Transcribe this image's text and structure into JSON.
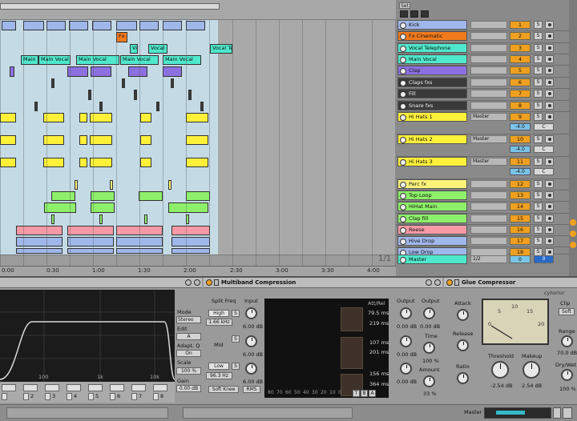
{
  "header": {
    "set_label": "Set"
  },
  "ruler": {
    "times": [
      "0:00",
      "0:30",
      "1:00",
      "1:30",
      "2:00",
      "2:30",
      "3:00",
      "3:30",
      "4:00"
    ],
    "position": "1/1"
  },
  "clip_labels": {
    "fx": "Fx Ci",
    "v": "Vi",
    "vocal": "Vocal",
    "vocal_tel": "Vocal Te",
    "main_a": "Main V",
    "main_b": "Main Vocal",
    "main_c": "Main Vocal",
    "main_d": "Main Vocal",
    "main_e": "Main Vocal"
  },
  "tracks": [
    {
      "name": "Kick",
      "num": "1",
      "color": "#9fb7ea"
    },
    {
      "name": "Fx Cinematic",
      "num": "2",
      "color": "#f07a1c"
    },
    {
      "name": "Vocal Telephone",
      "num": "3",
      "color": "#4fe8cc"
    },
    {
      "name": "Main Vocal",
      "num": "4",
      "color": "#4fe8cc"
    },
    {
      "name": "Clap",
      "num": "5",
      "color": "#8c70e0"
    },
    {
      "name": "Claps fxs",
      "num": "6",
      "color": "#3a3a3a"
    },
    {
      "name": "Fill",
      "num": "7",
      "color": "#3a3a3a"
    },
    {
      "name": "Snare fxs",
      "num": "8",
      "color": "#3a3a3a"
    },
    {
      "name": "Hi Hats 1",
      "num": "9",
      "color": "#fff03a",
      "out": "Master",
      "vol": "-4.0",
      "pan": "C"
    },
    {
      "name": "Hi Hats 2",
      "num": "10",
      "color": "#fff03a",
      "out": "Master",
      "vol": "-4.0",
      "pan": "C"
    },
    {
      "name": "Hi Hats 3",
      "num": "11",
      "color": "#fff03a",
      "out": "Master",
      "vol": "-4.0",
      "pan": "C"
    },
    {
      "name": "Perc fx",
      "num": "12",
      "color": "#fff27a"
    },
    {
      "name": "Top Loop",
      "num": "13",
      "color": "#8ef06a"
    },
    {
      "name": "HiHat Main",
      "num": "14",
      "color": "#8ef06a"
    },
    {
      "name": "Clap fill",
      "num": "15",
      "color": "#8ef06a"
    },
    {
      "name": "Reese",
      "num": "16",
      "color": "#f79aa6"
    },
    {
      "name": "Hive Drop",
      "num": "17",
      "color": "#9fb7ea"
    },
    {
      "name": "Low Drop",
      "num": "18",
      "color": "#9fb7ea"
    }
  ],
  "master": {
    "name": "Master",
    "io": "1/2",
    "vol": "0",
    "pan": "0"
  },
  "solo_label": "S",
  "eq": {
    "freq_labels": [
      "100",
      "1k",
      "10k"
    ],
    "mode_label": "Mode",
    "mode_value": "Stereo",
    "edit_label": "Edit",
    "edit_value": "A",
    "adapt_label": "Adapt. Q",
    "adapt_value": "On",
    "scale_label": "Scale",
    "scale_value": "100 %",
    "gain_label": "Gain",
    "gain_value": "0.00 dB",
    "band_numbers": [
      "2",
      "3",
      "4",
      "5",
      "6",
      "7",
      "8"
    ]
  },
  "mbc": {
    "title": "Multiband Compression",
    "split_label": "Split Freq",
    "input_label": "Input",
    "high_label": "High",
    "high_freq": "1.66 kHz",
    "high_in": "6.00 dB",
    "mid_label": "Mid",
    "mid_in": "6.00 dB",
    "low_label": "Low",
    "low_freq": "96.3 Hz",
    "low_in": "6.00 dB",
    "soft_knee": "Soft Knee",
    "rms": "RMS",
    "att_rel": "Att/Rel",
    "att_values": [
      "79.5 ms",
      "219 ms",
      "107 ms",
      "201 ms",
      "156 ms",
      "364 ms"
    ],
    "scale": [
      "80",
      "70",
      "60",
      "50",
      "40",
      "30",
      "20",
      "10",
      "0"
    ],
    "tb": [
      "T",
      "B",
      "A"
    ],
    "output_label": "Output",
    "output_values": [
      "0.00 dB",
      "0.00 dB",
      "0.00 dB"
    ],
    "output2_label": "Output",
    "output2_value": "0.00 dB",
    "time_label": "Time",
    "time_value": "100 %",
    "amount_label": "Amount",
    "amount_value": "33 %"
  },
  "glue": {
    "title": "Glue Compressor",
    "attack_label": "Attack",
    "release_label": "Release",
    "ratio_label": "Ratio",
    "meter_scale": [
      "0",
      "5",
      "10",
      "15",
      "20"
    ],
    "threshold_label": "Threshold",
    "threshold_value": "-2.54 dB",
    "makeup_label": "Makeup",
    "makeup_value": "2.54 dB",
    "clip_label": "Clip",
    "soft_label": "Soft",
    "range_label": "Range",
    "range_value": "70.0 dB",
    "drywet_label": "Dry/Wet",
    "drywet_value": "100 %",
    "brand": "cytomic"
  },
  "status": {
    "master_label": "Master"
  }
}
